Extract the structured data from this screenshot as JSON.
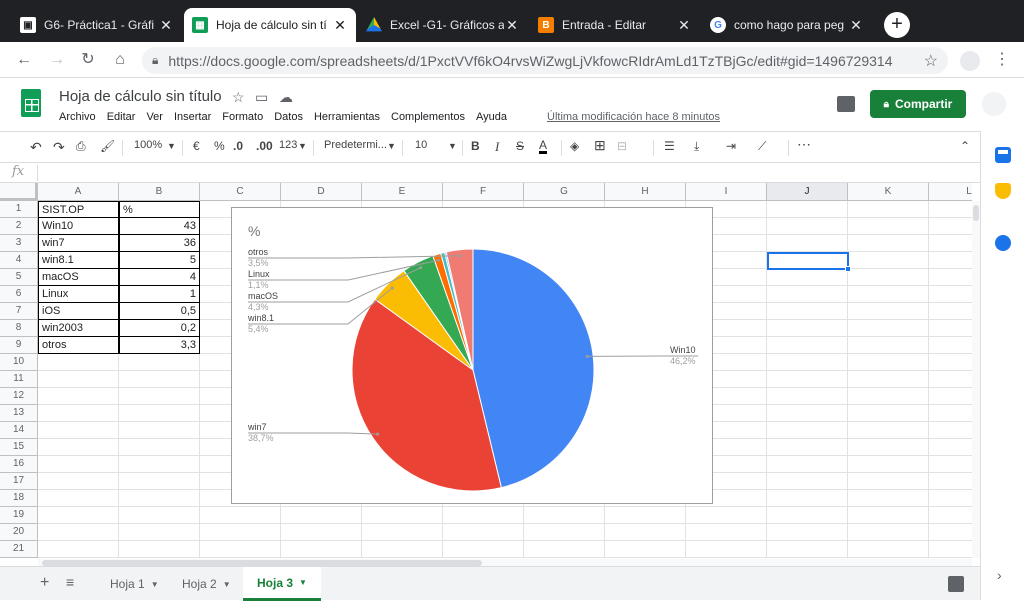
{
  "browser": {
    "tabs": [
      {
        "title": "G6- Práctica1 - Gráfi",
        "icon": "doc-icon"
      },
      {
        "title": "Hoja de cálculo sin tí",
        "icon": "sheets-icon"
      },
      {
        "title": "Excel -G1- Gráficos a",
        "icon": "drive-icon"
      },
      {
        "title": "Entrada - Editar",
        "icon": "blogger-icon"
      },
      {
        "title": "como hago para peg",
        "icon": "google-icon"
      }
    ],
    "new_tab": "+",
    "close_glyph": "✕",
    "url": "https://docs.google.com/spreadsheets/d/1PxctVVf6kO4rvsWiZwgLjVkfowcRIdrAmLd1TzTBjGc/edit#gid=1496729314"
  },
  "doc": {
    "title": "Hoja de cálculo sin título",
    "menus": [
      "Archivo",
      "Editar",
      "Ver",
      "Insertar",
      "Formato",
      "Datos",
      "Herramientas",
      "Complementos",
      "Ayuda"
    ],
    "last_modified": "Última modificación hace 8 minutos",
    "share_label": "Compartir"
  },
  "format_toolbar": {
    "zoom": "100%",
    "currency": "€",
    "percent": "%",
    "decrease_decimals": ".0",
    "increase_decimals": ".00",
    "more_formats": "123",
    "font": "Predetermi...",
    "font_size": "10",
    "bold": "B",
    "italic": "I",
    "strike": "S",
    "text_color": "A",
    "more": "⋯"
  },
  "formula_bar": {
    "fx": "fx",
    "value": ""
  },
  "grid": {
    "columns": [
      "A",
      "B",
      "C",
      "D",
      "E",
      "F",
      "G",
      "H",
      "I",
      "J",
      "K",
      "L"
    ],
    "rows": [
      "1",
      "2",
      "3",
      "4",
      "5",
      "6",
      "7",
      "8",
      "9",
      "10",
      "11",
      "12",
      "13",
      "14",
      "15",
      "16",
      "17",
      "18",
      "19",
      "20",
      "21"
    ],
    "table": [
      [
        "SIST.OP",
        "%"
      ],
      [
        "Win10",
        "43"
      ],
      [
        "win7",
        "36"
      ],
      [
        "win8.1",
        "5"
      ],
      [
        "macOS",
        "4"
      ],
      [
        "Linux",
        "1"
      ],
      [
        "iOS",
        "0,5"
      ],
      [
        "win2003",
        "0,2"
      ],
      [
        "otros",
        "3,3"
      ]
    ]
  },
  "chart_data": {
    "type": "pie",
    "title": "%",
    "categories": [
      "Win10",
      "win7",
      "win8.1",
      "macOS",
      "Linux",
      "iOS",
      "win2003",
      "otros"
    ],
    "values": [
      43,
      36,
      5,
      4,
      1,
      0.5,
      0.2,
      3.3
    ],
    "labels": [
      {
        "name": "Win10",
        "pct": "46,2%"
      },
      {
        "name": "win7",
        "pct": "38,7%"
      },
      {
        "name": "win8.1",
        "pct": "5,4%"
      },
      {
        "name": "macOS",
        "pct": "4,3%"
      },
      {
        "name": "Linux",
        "pct": "1,1%"
      },
      {
        "name": "otros",
        "pct": "3,5%"
      }
    ],
    "colors": [
      "#4285f4",
      "#ea4335",
      "#fbbc04",
      "#34a853",
      "#ff6d01",
      "#46bdc6",
      "#7baaf7",
      "#f07b72"
    ]
  },
  "sheets": [
    "Hoja 1",
    "Hoja 2",
    "Hoja 3"
  ],
  "active_sheet": "Hoja 3"
}
